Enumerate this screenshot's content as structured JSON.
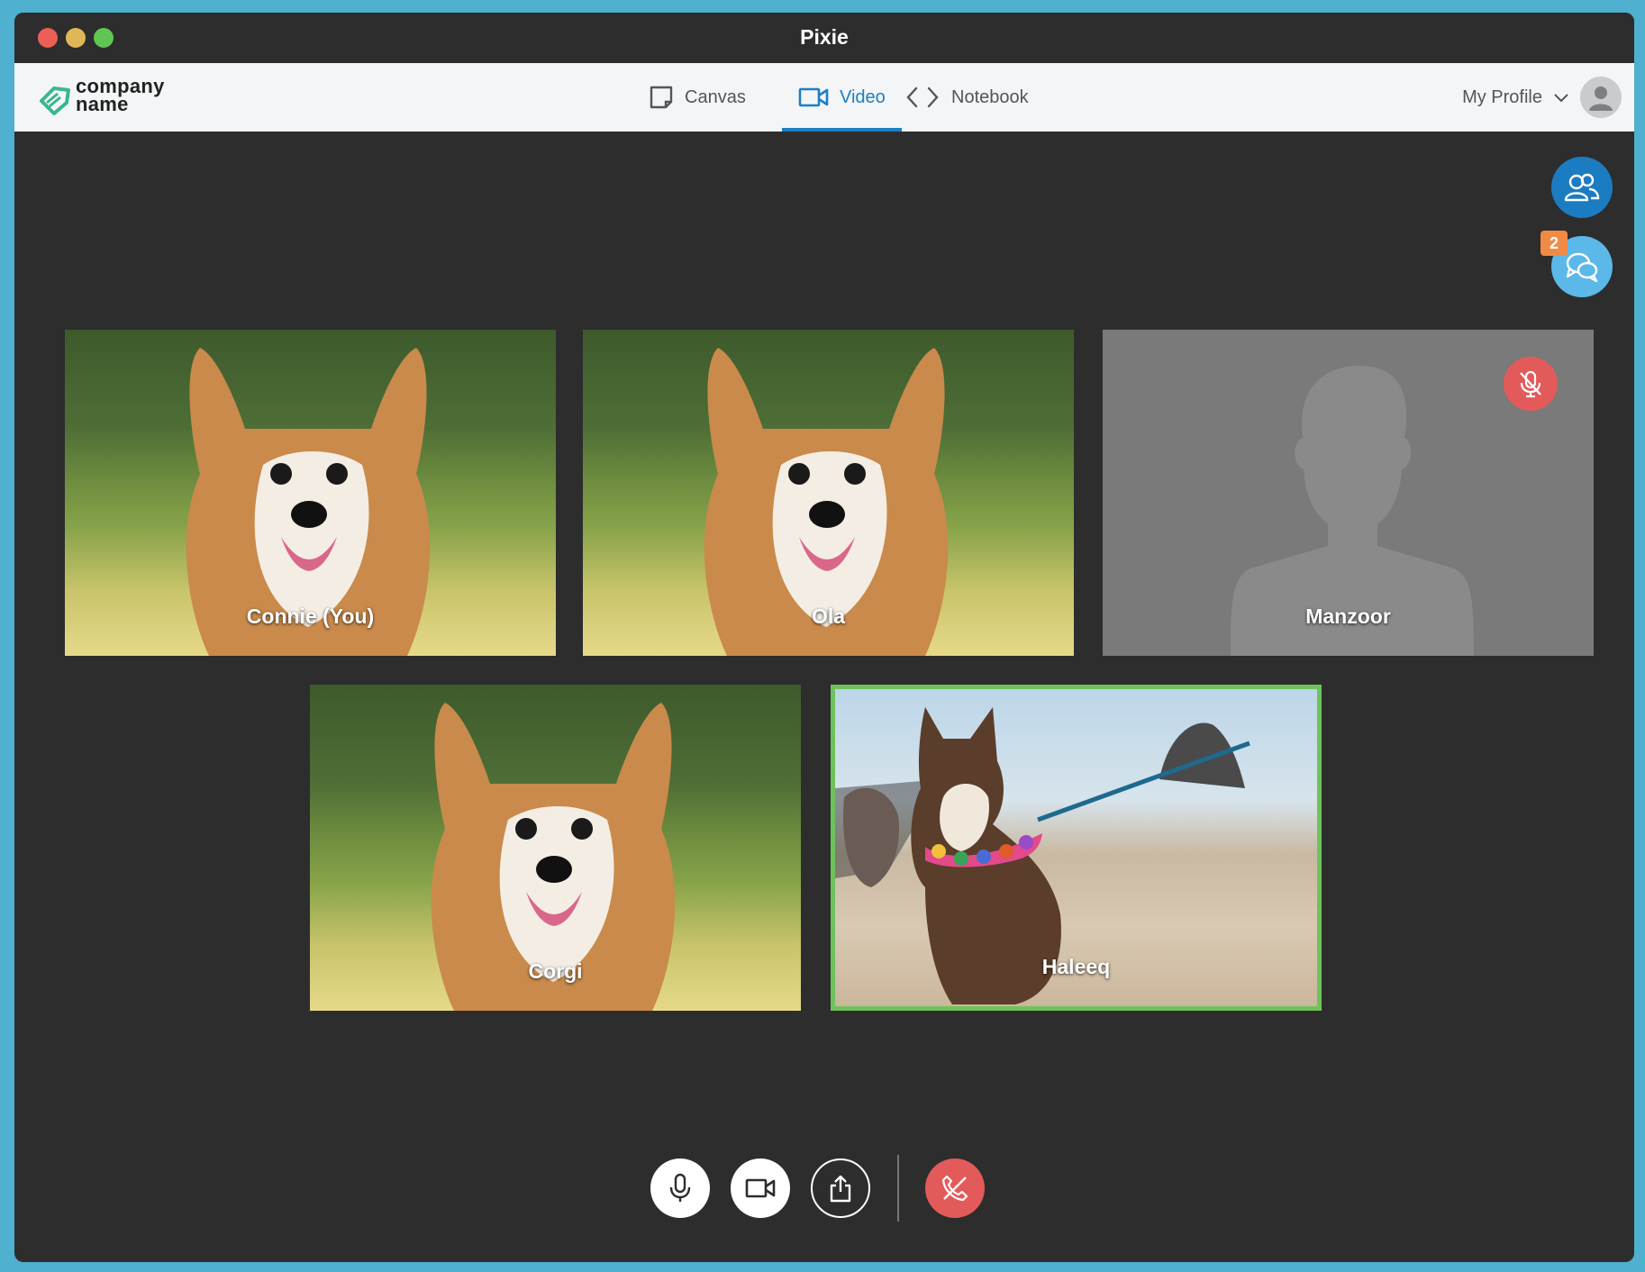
{
  "window": {
    "title": "Pixie"
  },
  "brand": {
    "line1": "company",
    "line2": "name"
  },
  "nav": {
    "tabs": [
      {
        "label": "Canvas",
        "icon": "canvas-icon",
        "active": false
      },
      {
        "label": "Video",
        "icon": "video-camera-icon",
        "active": true
      },
      {
        "label": "Notebook",
        "icon": "code-brackets-icon",
        "active": false
      }
    ],
    "profile_label": "My Profile"
  },
  "side_actions": {
    "participants_icon": "participants-icon",
    "chat_icon": "chat-icon",
    "chat_badge": "2"
  },
  "participants": [
    {
      "name": "Connie (You)",
      "background": "corgi-park",
      "muted": false,
      "speaking": false
    },
    {
      "name": "Ola",
      "background": "corgi-park",
      "muted": false,
      "speaking": false
    },
    {
      "name": "Manzoor",
      "background": "silhouette",
      "muted": true,
      "speaking": false
    },
    {
      "name": "Corgi",
      "background": "corgi-park",
      "muted": false,
      "speaking": false
    },
    {
      "name": "Haleeq",
      "background": "corgi-beach",
      "muted": false,
      "speaking": true
    }
  ],
  "controls": {
    "mic": "microphone-icon",
    "camera": "video-camera-icon",
    "share": "share-icon",
    "end": "end-call-icon"
  },
  "colors": {
    "accent": "#1e7fc2",
    "speaking_border": "#6ec25b",
    "danger": "#e35a5a",
    "badge": "#f08a44"
  }
}
